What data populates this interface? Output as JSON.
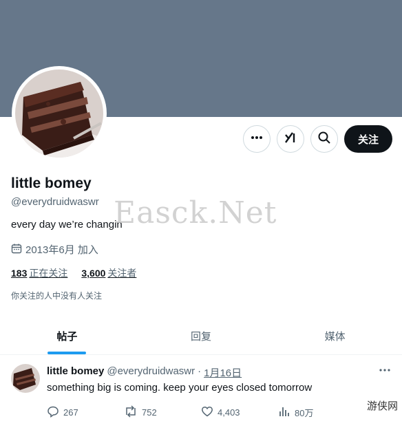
{
  "profile": {
    "display_name": "little bomey",
    "handle": "@everydruidwaswr",
    "bio": "every day we’re changin",
    "joined": "2013年6月 加入",
    "following_count": "183",
    "following_label": "正在关注",
    "followers_count": "3,600",
    "followers_label": "关注者",
    "mutual_note": "你关注的人中没有人关注"
  },
  "actions": {
    "more_icon": "more-icon",
    "grok_icon": "grok-icon",
    "search_icon": "search-icon",
    "follow_label": "关注"
  },
  "tabs": [
    {
      "label": "帖子",
      "active": true
    },
    {
      "label": "回复",
      "active": false
    },
    {
      "label": "媒体",
      "active": false
    }
  ],
  "tweet": {
    "name": "little bomey",
    "handle": "@everydruidwaswr",
    "separator": "·",
    "date": "1月16日",
    "text": "something big is coming. keep your eyes closed tomorrow",
    "replies": "267",
    "reposts": "752",
    "likes": "4,403",
    "views": "80万"
  },
  "watermark": "Easck.Net",
  "corner_mark": "游侠网",
  "colors": {
    "banner": "#66778a",
    "follow_button": "#0f1419",
    "tab_indicator": "#1d9bf0",
    "secondary_text": "#536471"
  }
}
